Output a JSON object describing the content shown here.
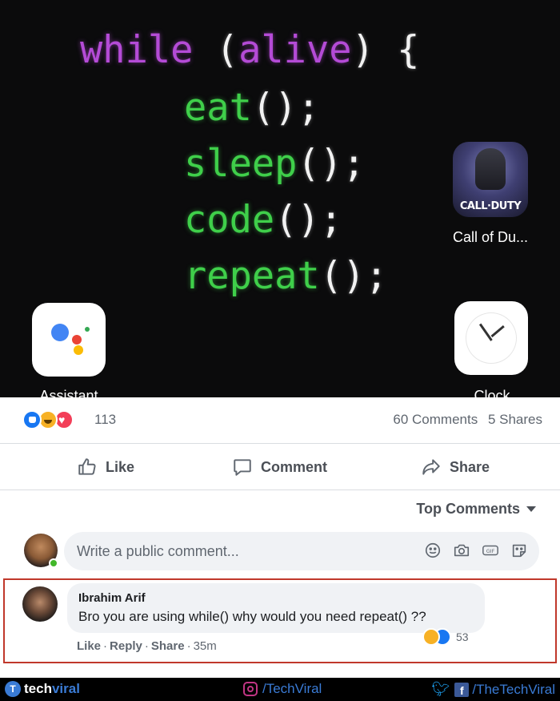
{
  "screen": {
    "code": {
      "line0": {
        "kw": "while",
        "mid": " (",
        "cond": "alive",
        "end": ") {"
      },
      "line1": {
        "fn": "eat",
        "call": "();"
      },
      "line2": {
        "fn": "sleep",
        "call": "();"
      },
      "line3": {
        "fn": "code",
        "call": "();"
      },
      "line4": {
        "fn": "repeat",
        "call": "();"
      }
    },
    "apps": [
      {
        "label": "Call of Du...",
        "icon_text": "CALL·DUTY",
        "icon": "call-of-duty-icon"
      },
      {
        "label": "Assistant",
        "icon": "google-assistant-icon"
      },
      {
        "label": "Clock",
        "icon": "clock-icon"
      }
    ]
  },
  "post": {
    "reaction_count": "113",
    "comments": "60 Comments",
    "shares": "5 Shares",
    "actions": {
      "like": "Like",
      "comment": "Comment",
      "share": "Share"
    },
    "sort_label": "Top Comments",
    "write_placeholder": "Write a public comment..."
  },
  "comment": {
    "author": "Ibrahim Arif",
    "text": "Bro you are using while() why would you need repeat() ??",
    "reaction_count": "53",
    "actions": {
      "like": "Like",
      "reply": "Reply",
      "share": "Share",
      "time": "35m"
    }
  },
  "watermark": {
    "brand_a": "tech",
    "brand_b": "viral",
    "instagram": "/TechViral",
    "social": "/TheTechViral"
  },
  "colors": {
    "keyword": "#b44bd6",
    "code_green": "#3fcf4a",
    "facebook_blue": "#1877f2",
    "highlight_border": "#c0382b"
  }
}
